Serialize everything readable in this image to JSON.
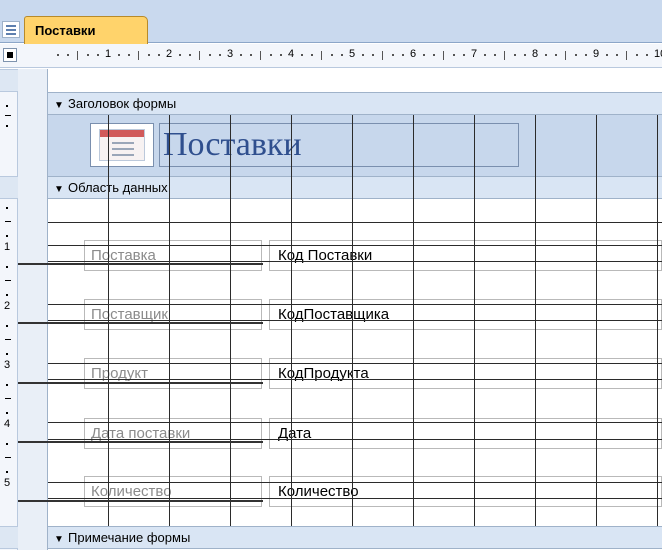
{
  "tab": {
    "title": "Поставки"
  },
  "ruler": {
    "numbers": [
      "1",
      "2",
      "3",
      "4",
      "5",
      "6",
      "7",
      "8",
      "9",
      "10"
    ],
    "vnumbers": [
      "1",
      "2",
      "3",
      "4",
      "5"
    ]
  },
  "sections": {
    "header": "Заголовок формы",
    "detail": "Область данных",
    "footer": "Примечание формы"
  },
  "header": {
    "title": "Поставки"
  },
  "rows": [
    {
      "label": "Поставка",
      "field": "Код Поставки"
    },
    {
      "label": "Поставщик",
      "field": "КодПоставщика"
    },
    {
      "label": "Продукт",
      "field": "КодПродукта"
    },
    {
      "label": "Дата поставки",
      "field": "Дата"
    },
    {
      "label": "Количество",
      "field": "Количество"
    }
  ],
  "colors": {
    "tab": "#ffd36b",
    "band": "#d9e5f4",
    "header": "#c7d7ec",
    "title": "#2f4f8e"
  }
}
